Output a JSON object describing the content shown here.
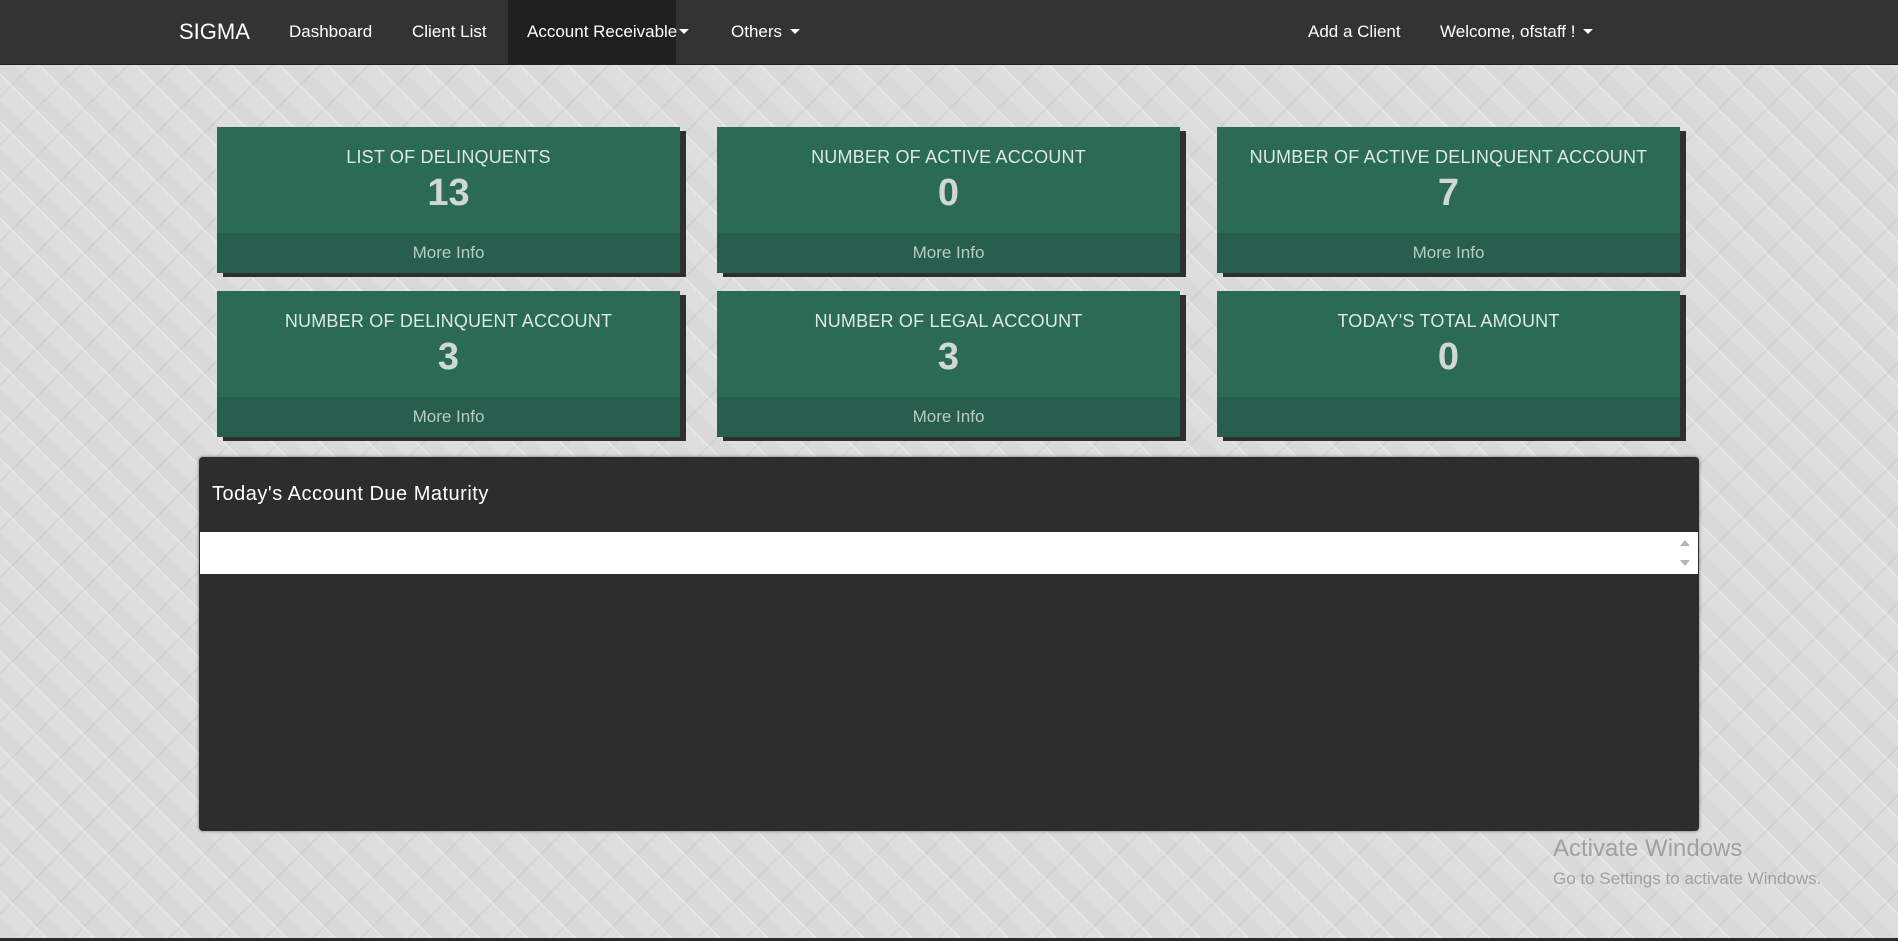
{
  "navbar": {
    "brand": "SIGMA",
    "items": [
      {
        "label": "Dashboard"
      },
      {
        "label": "Client List"
      },
      {
        "label": "Account Receivable",
        "active": true,
        "dropdown": true
      },
      {
        "label": "Others",
        "dropdown": true
      }
    ],
    "right": {
      "add_client": "Add a Client",
      "welcome": "Welcome, ofstaff !"
    }
  },
  "cards": [
    {
      "title": "LIST OF DELINQUENTS",
      "value": "13",
      "footer": "More Info"
    },
    {
      "title": "NUMBER OF ACTIVE ACCOUNT",
      "value": "0",
      "footer": "More Info"
    },
    {
      "title": "NUMBER OF ACTIVE DELINQUENT ACCOUNT",
      "value": "7",
      "footer": "More Info"
    },
    {
      "title": "NUMBER OF DELINQUENT ACCOUNT",
      "value": "3",
      "footer": "More Info"
    },
    {
      "title": "NUMBER OF LEGAL ACCOUNT",
      "value": "3",
      "footer": "More Info"
    },
    {
      "title": "TODAY'S TOTAL AMOUNT",
      "value": "0",
      "footer": ""
    }
  ],
  "panel": {
    "title": "Today's Account Due Maturity"
  },
  "watermark": {
    "title": "Activate Windows",
    "subtitle": "Go to Settings to activate Windows."
  },
  "colors": {
    "navbar": "#333333",
    "card": "#2b6a55",
    "card_footer": "#275e4d",
    "panel": "#2d2d2d"
  }
}
